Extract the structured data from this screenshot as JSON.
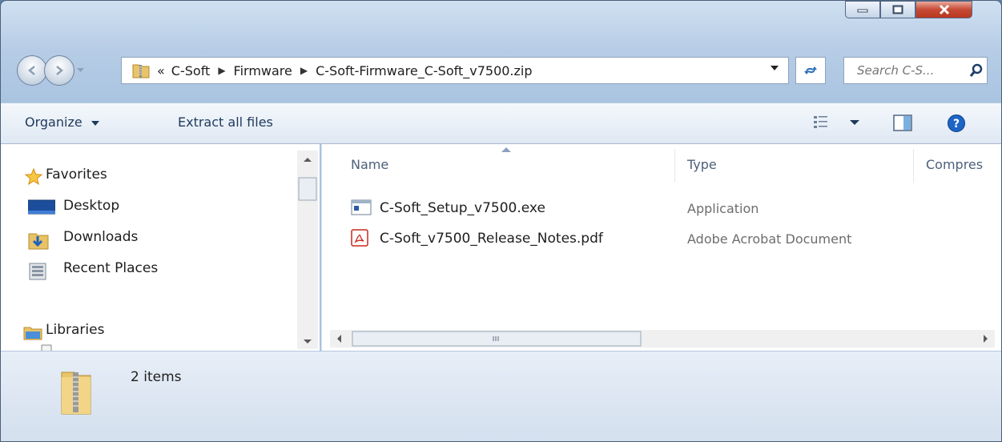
{
  "window": {
    "caption": {
      "minimize": "minimize",
      "maximize": "maximize",
      "close": "close"
    }
  },
  "address": {
    "overflow": "«",
    "crumbs": [
      "C-Soft",
      "Firmware",
      "C-Soft-Firmware_C-Soft_v7500.zip"
    ]
  },
  "search": {
    "placeholder": "Search C-S..."
  },
  "toolbar": {
    "organize_label": "Organize",
    "extract_label": "Extract all files"
  },
  "sidebar": {
    "favorites_label": "Favorites",
    "items": [
      {
        "label": "Desktop",
        "icon": "desktop-icon"
      },
      {
        "label": "Downloads",
        "icon": "downloads-icon"
      },
      {
        "label": "Recent Places",
        "icon": "recent-places-icon"
      }
    ],
    "libraries_label": "Libraries"
  },
  "columns": {
    "name": "Name",
    "type": "Type",
    "compressed": "Compres"
  },
  "files": [
    {
      "name": "C-Soft_Setup_v7500.exe",
      "type": "Application",
      "icon": "application-icon"
    },
    {
      "name": "C-Soft_v7500_Release_Notes.pdf",
      "type": "Adobe Acrobat Document",
      "icon": "pdf-icon"
    }
  ],
  "status": {
    "count": "2 items"
  },
  "colors": {
    "accent": "#1e395b",
    "title_gradient_top": "#cfe0f1",
    "close_red": "#c74a34"
  }
}
